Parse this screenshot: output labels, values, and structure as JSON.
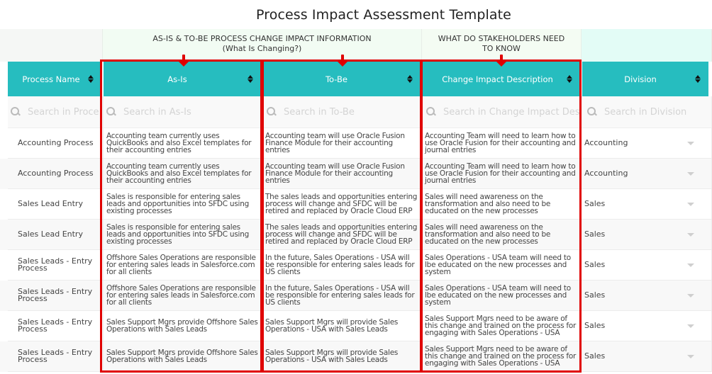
{
  "title": "Process Impact Assessment Template",
  "group_headers": {
    "as_is_to_be_line1": "AS-IS & TO-BE PROCESS CHANGE IMPACT INFORMATION",
    "as_is_to_be_line2": "(What Is Changing?)",
    "stakeholders": "WHAT DO STAKEHOLDERS NEED TO KNOW"
  },
  "columns": [
    {
      "key": "process_name",
      "label": "Process Name",
      "search_placeholder": "Search in Proce"
    },
    {
      "key": "as_is",
      "label": "As-Is",
      "search_placeholder": "Search in As-Is"
    },
    {
      "key": "to_be",
      "label": "To-Be",
      "search_placeholder": "Search in To-Be"
    },
    {
      "key": "change_impact",
      "label": "Change Impact Description",
      "search_placeholder": "Search in Change Impact Des"
    },
    {
      "key": "division",
      "label": "Division",
      "search_placeholder": "Search in Division"
    }
  ],
  "rows": [
    {
      "process_name": "Accounting Process",
      "as_is": "Accounting team currently uses QuickBooks and also Excel templates for their accounting entries",
      "to_be": "Accounting team will use Oracle Fusion Finance Module for their accounting entries",
      "change_impact": "Accounting Team will need to learn how to use Oracle Fusion for their accounting and journal entries",
      "division": "Accounting"
    },
    {
      "process_name": "Accounting Process",
      "as_is": "Accounting team currently uses QuickBooks and also Excel templates for their accounting entries",
      "to_be": "Accounting team will use Oracle Fusion Finance Module for their accounting entries",
      "change_impact": "Accounting Team will need to learn how to use Oracle Fusion for their accounting and journal entries",
      "division": "Accounting"
    },
    {
      "process_name": "Sales Lead Entry",
      "as_is": "Sales is responsible for entering sales leads and opportunities into SFDC using existing processes",
      "to_be": "The sales leads and opportunities entering process will change and SFDC will be retired and replaced by Oracle Cloud ERP",
      "change_impact": "Sales will need awareness on the transformation and also need to be educated on the new processes",
      "division": "Sales"
    },
    {
      "process_name": "Sales Lead Entry",
      "as_is": "Sales is responsible for entering sales leads and opportunities into SFDC using existing processes",
      "to_be": "The sales leads and opportunities entering process will change and SFDC will be retired and replaced by Oracle Cloud ERP",
      "change_impact": "Sales will need awareness on the transformation and also need to be educated on the new processes",
      "division": "Sales"
    },
    {
      "process_name": "Sales Leads - Entry Process",
      "as_is": "Offshore Sales Operations are responsible for entering sales leads in Salesforce.com for all clients",
      "to_be": "In the future, Sales Operations - USA will be responsible for entering sales leads for US clients",
      "change_impact": "Sales Operations - USA team will need to lbe educated on the new processes and system",
      "division": "Sales"
    },
    {
      "process_name": "Sales Leads - Entry Process",
      "as_is": "Offshore Sales Operations are responsible for entering sales leads in Salesforce.com for all clients",
      "to_be": "In the future, Sales Operations - USA will be responsible for entering sales leads for US clients",
      "change_impact": "Sales Operations - USA team will need to lbe educated on the new processes and system",
      "division": "Sales"
    },
    {
      "process_name": "Sales Leads - Entry Process",
      "as_is": "Sales Support Mgrs provide Offshore Sales Operations with Sales Leads",
      "to_be": "Sales Support Mgrs will provide Sales Operations - USA with Sales Leads",
      "change_impact": "Sales Support Mgrs need to be aware of this change and trained on the process for engaging with Sales Operations - USA",
      "division": "Sales"
    },
    {
      "process_name": "Sales Leads - Entry Process",
      "as_is": "Sales Support Mgrs provide Offshore Sales Operations with Sales Leads",
      "to_be": "Sales Support Mgrs will provide Sales Operations - USA with Sales Leads",
      "change_impact": "Sales Support Mgrs need to be aware of this change and trained on the process for engaging with Sales Operations - USA",
      "division": "Sales"
    }
  ],
  "colors": {
    "header_bg": "#26bdbf",
    "annotation_red": "#e00000"
  }
}
